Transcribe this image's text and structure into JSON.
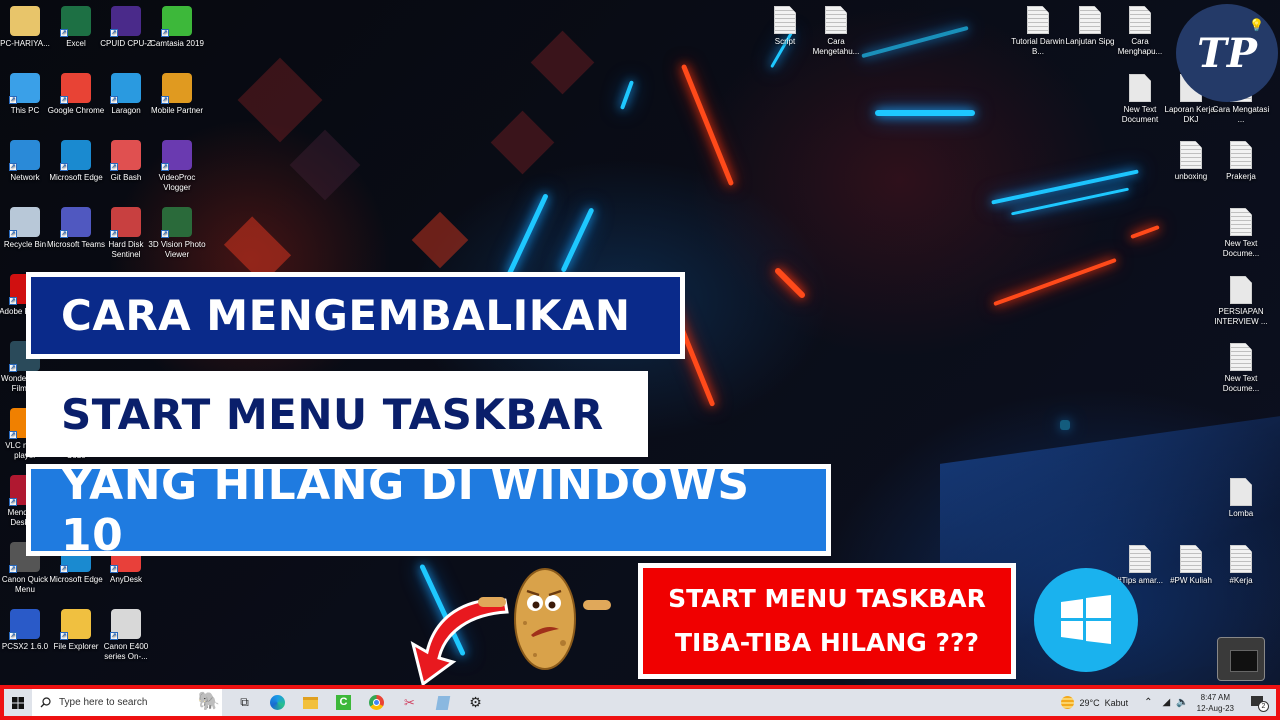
{
  "desktop": {
    "left_icons": [
      {
        "label": "PC-HARIYA...",
        "icon": "user-folder-icon",
        "color": "#e8c56a"
      },
      {
        "label": "Excel",
        "icon": "excel-icon",
        "color": "#1d7044"
      },
      {
        "label": "CPUID CPU-Z",
        "icon": "cpuz-icon",
        "color": "#4a2a8a"
      },
      {
        "label": "Camtasia 2019",
        "icon": "camtasia-icon",
        "color": "#3db83a"
      },
      {
        "label": "This PC",
        "icon": "this-pc-icon",
        "color": "#3aa0e8"
      },
      {
        "label": "Google Chrome",
        "icon": "chrome-icon",
        "color": "#e84335"
      },
      {
        "label": "Laragon",
        "icon": "laragon-icon",
        "color": "#2a9ae0"
      },
      {
        "label": "Mobile Partner",
        "icon": "mobile-partner-icon",
        "color": "#e09a20"
      },
      {
        "label": "Network",
        "icon": "network-icon",
        "color": "#2a8ad8"
      },
      {
        "label": "Microsoft Edge",
        "icon": "edge-icon",
        "color": "#1a8ad0"
      },
      {
        "label": "Git Bash",
        "icon": "git-bash-icon",
        "color": "#e05050"
      },
      {
        "label": "VideoProc Vlogger",
        "icon": "videoproc-icon",
        "color": "#6a3ab0"
      },
      {
        "label": "Recycle Bin",
        "icon": "recycle-bin-icon",
        "color": "#b8c8d8"
      },
      {
        "label": "Microsoft Teams",
        "icon": "teams-icon",
        "color": "#5058c0"
      },
      {
        "label": "Hard Disk Sentinel",
        "icon": "hard-disk-sentinel-icon",
        "color": "#c84040"
      },
      {
        "label": "3D Vision Photo Viewer",
        "icon": "3d-vision-icon",
        "color": "#2a6a3a"
      },
      {
        "label": "Adobe Reader",
        "icon": "adobe-reader-icon",
        "color": "#d01010"
      },
      {
        "label": "Wondershare Filmora",
        "icon": "filmora-icon",
        "color": "#2a4a5a"
      },
      {
        "label": "VLC media player",
        "icon": "vlc-icon",
        "color": "#f08000"
      },
      {
        "label": "Visual Studio Code",
        "icon": "vscode-icon",
        "color": "#1a78c8"
      },
      {
        "label": "Mendeley Desktop",
        "icon": "mendeley-icon",
        "color": "#b01830"
      },
      {
        "label": "Canon Quick Menu",
        "icon": "canon-quick-menu-icon",
        "color": "#555555"
      },
      {
        "label": "Microsoft Edge",
        "icon": "edge-icon",
        "color": "#1a8ad0"
      },
      {
        "label": "AnyDesk",
        "icon": "anydesk-icon",
        "color": "#e8403a"
      },
      {
        "label": "PCSX2 1.6.0",
        "icon": "pcsx2-icon",
        "color": "#2a5ac8"
      },
      {
        "label": "File Explorer",
        "icon": "file-explorer-icon",
        "color": "#f0c040"
      },
      {
        "label": "Canon E400 series On-...",
        "icon": "canon-help-icon",
        "color": "#d8d8d8"
      }
    ],
    "right_icons": [
      {
        "label": "Script"
      },
      {
        "label": "Cara Mengetahu..."
      },
      {
        "label": "Tutorial Darwin B..."
      },
      {
        "label": "Lanjutan Sipg"
      },
      {
        "label": "Cara Menghapu..."
      },
      {
        "label": "New Text Document"
      },
      {
        "label": "Laporan Kerja-DKJ"
      },
      {
        "label": "Cara Mengatasi ..."
      },
      {
        "label": "unboxing"
      },
      {
        "label": "Prakerja"
      },
      {
        "label": "New Text Docume..."
      },
      {
        "label": "PERSIAPAN INTERVIEW ..."
      },
      {
        "label": "New Text Docume..."
      },
      {
        "label": "Lomba"
      },
      {
        "label": "#Tips amar..."
      },
      {
        "label": "#PW Kuliah"
      },
      {
        "label": "#Kerja"
      }
    ]
  },
  "overlay": {
    "title_line1": "CARA MENGEMBALIKAN",
    "title_line2": "START MENU TASKBAR",
    "title_line3": "YANG HILANG DI WINDOWS 10",
    "callout_line1": "START MENU TASKBAR",
    "callout_line2": "TIBA-TIBA HILANG ???",
    "channel_logo_text": "TP",
    "colors": {
      "banner_dark_blue": "#0a2a8a",
      "banner_text_navy": "#0a1f6b",
      "banner_bright_blue": "#1f7be0",
      "callout_red": "#f00000",
      "windows_blue": "#1ab2ee",
      "taskbar_highlight": "#ee1111"
    }
  },
  "taskbar": {
    "search_placeholder": "Type here to search",
    "pinned_apps": [
      {
        "name": "task-view-icon"
      },
      {
        "name": "edge-icon"
      },
      {
        "name": "file-explorer-icon"
      },
      {
        "name": "camtasia-icon"
      },
      {
        "name": "chrome-icon"
      },
      {
        "name": "snipping-tool-icon"
      },
      {
        "name": "notepad-icon"
      },
      {
        "name": "settings-icon"
      }
    ],
    "weather_temp": "29°C",
    "weather_desc": "Kabut",
    "time": "8:47 AM",
    "date": "12-Aug-23",
    "notification_count": "2"
  }
}
